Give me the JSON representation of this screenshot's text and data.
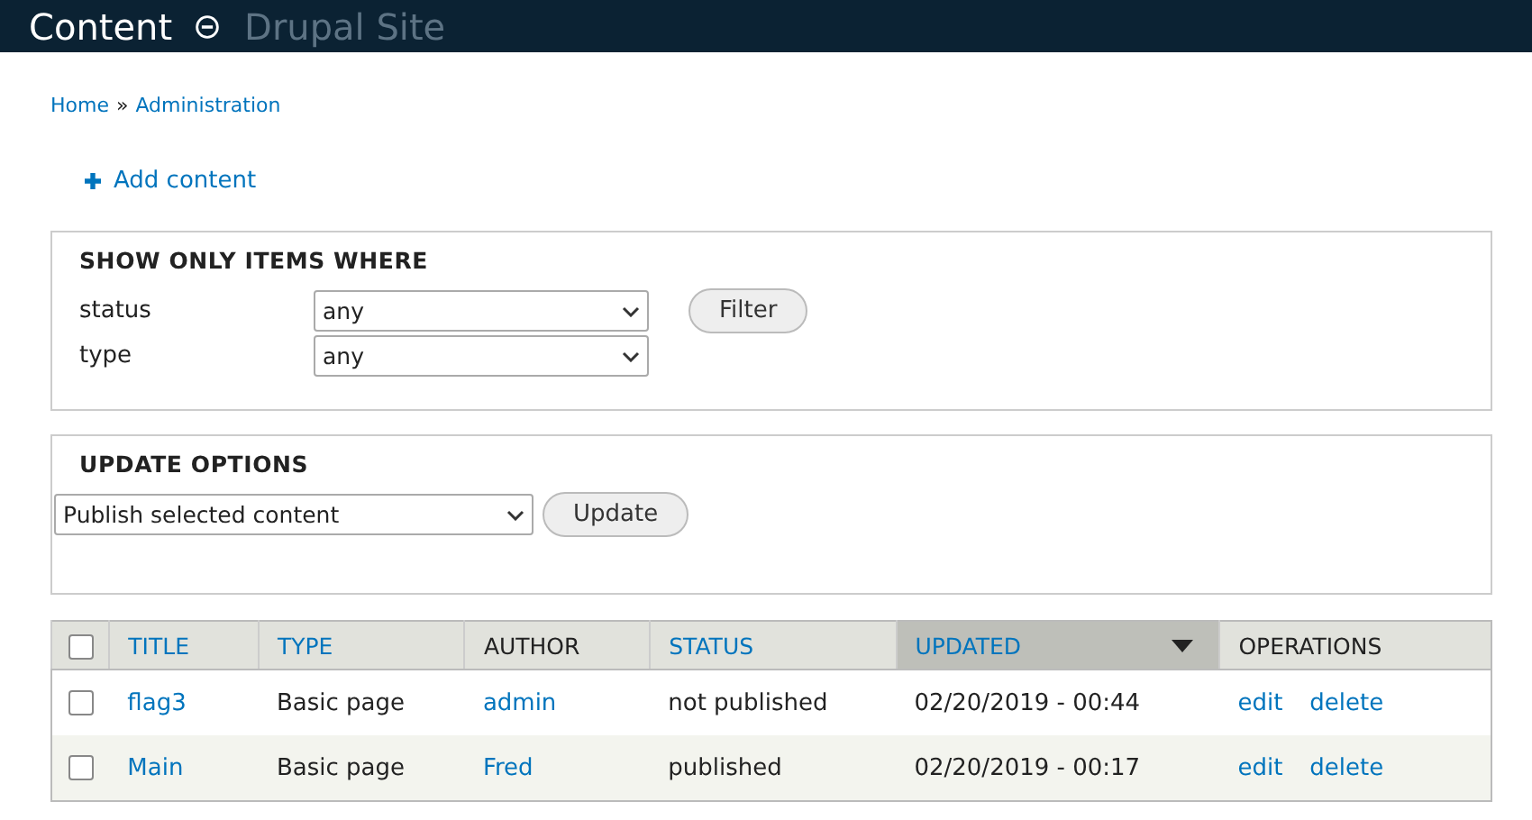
{
  "header": {
    "title": "Content",
    "site_name": "Drupal Site"
  },
  "breadcrumb": [
    "Home",
    "Administration"
  ],
  "breadcrumb_separator": "»",
  "action_link": "Add content",
  "filter": {
    "legend": "SHOW ONLY ITEMS WHERE",
    "fields": [
      {
        "label": "status",
        "value": "any"
      },
      {
        "label": "type",
        "value": "any"
      }
    ],
    "button": "Filter"
  },
  "update": {
    "legend": "UPDATE OPTIONS",
    "value": "Publish selected content",
    "button": "Update"
  },
  "table": {
    "select_all_checked": false,
    "columns": [
      {
        "label": "TITLE",
        "link": true,
        "sorted": false
      },
      {
        "label": "TYPE",
        "link": true,
        "sorted": false
      },
      {
        "label": "AUTHOR",
        "link": false,
        "sorted": false
      },
      {
        "label": "STATUS",
        "link": true,
        "sorted": false
      },
      {
        "label": "UPDATED",
        "link": true,
        "sorted": true
      },
      {
        "label": "OPERATIONS",
        "link": false,
        "sorted": false
      }
    ],
    "rows": [
      {
        "checked": false,
        "title": "flag3",
        "type": "Basic page",
        "author": "admin",
        "status": "not published",
        "updated": "02/20/2019 - 00:44",
        "operations": [
          "edit",
          "delete"
        ]
      },
      {
        "checked": false,
        "title": "Main",
        "type": "Basic page",
        "author": "Fred",
        "status": "published",
        "updated": "02/20/2019 - 00:17",
        "operations": [
          "edit",
          "delete"
        ]
      }
    ]
  }
}
